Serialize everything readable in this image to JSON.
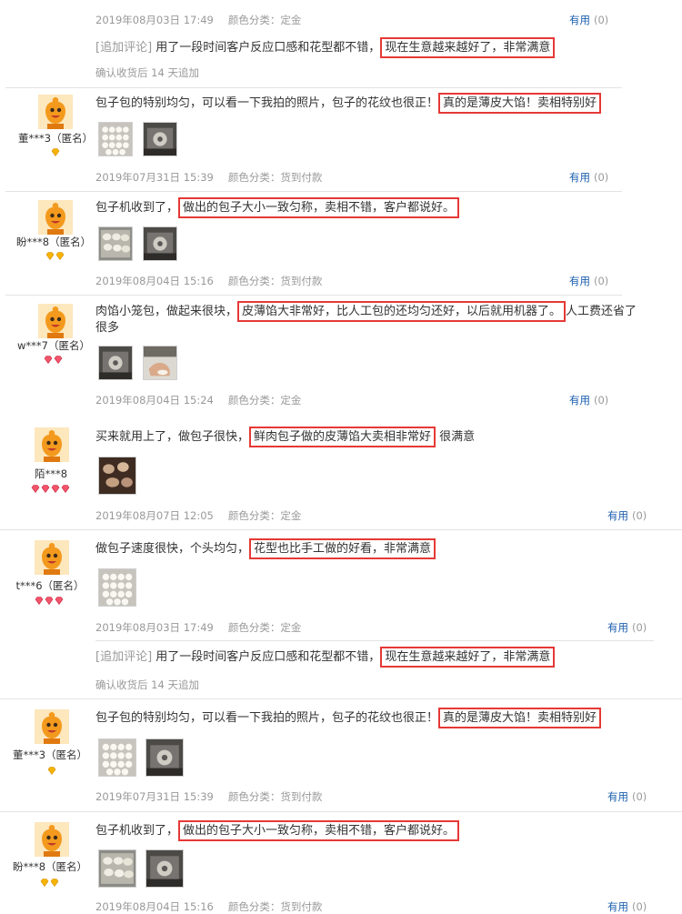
{
  "labels": {
    "helpful": "有用",
    "count": "(0)",
    "append_label": "[追加评论]",
    "append_when": "确认收货后 14 天追加",
    "category_prefix": "颜色分类："
  },
  "reviews": [
    {
      "date": "2019年08月03日 17:49",
      "category": "定金",
      "append_text": "用了一段时间客户反应口感和花型都不错，",
      "append_highlight": "现在生意越来越好了，非常满意"
    },
    {
      "user": "董***3（匿名）",
      "text_before": "包子包的特别均匀，可以看一下我拍的照片，包子的花纹也很正！",
      "highlight": "真的是薄皮大馅！卖相特别好",
      "text_after": "",
      "date": "2019年07月31日 15:39",
      "category": "货到付款"
    },
    {
      "user": "盼***8（匿名）",
      "text_before": "包子机收到了，",
      "highlight": "做出的包子大小一致匀称，卖相不错，客户都说好。",
      "text_after": "",
      "date": "2019年08月04日 15:16",
      "category": "货到付款"
    },
    {
      "user": "w***7（匿名）",
      "text_before": "肉馅小笼包，做起来很块，",
      "highlight": "皮薄馅大非常好，比人工包的还均匀还好，以后就用机器了。",
      "text_after": "人工费还省了",
      "text_line2": "很多",
      "date": "2019年08月04日 15:24",
      "category": "定金"
    },
    {
      "user": "陌***8",
      "text_before": "买来就用上了，做包子很快，",
      "highlight": "鲜肉包子做的皮薄馅大卖相非常好",
      "text_after": " 很满意",
      "date": "2019年08月07日 12:05",
      "category": "定金"
    },
    {
      "user": "t***6（匿名）",
      "text_before": "做包子速度很快，个头均匀，",
      "highlight": "花型也比手工做的好看，非常满意",
      "text_after": "",
      "date": "2019年08月03日 17:49",
      "category": "定金",
      "append_text": "用了一段时间客户反应口感和花型都不错，",
      "append_highlight": "现在生意越来越好了，非常满意"
    },
    {
      "user": "董***3（匿名）",
      "text_before": "包子包的特别均匀，可以看一下我拍的照片，包子的花纹也很正！",
      "highlight": "真的是薄皮大馅！卖相特别好",
      "text_after": "",
      "date": "2019年07月31日 15:39",
      "category": "货到付款"
    },
    {
      "user": "盼***8（匿名）",
      "text_before": "包子机收到了，",
      "highlight": "做出的包子大小一致匀称，卖相不错，客户都说好。",
      "text_after": "",
      "date": "2019年08月04日 15:16",
      "category": "货到付款"
    }
  ],
  "colors": {
    "highlight_border": "#e53935",
    "helpful_link": "#1b5fae",
    "meta_text": "#999999",
    "separator": "#e3e3e3",
    "avatar_orange": "#f39a1e"
  }
}
